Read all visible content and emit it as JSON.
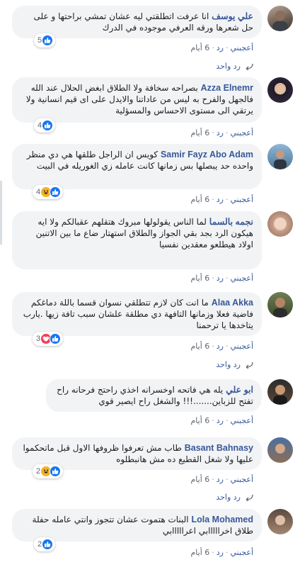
{
  "actions": {
    "like": "أعجبني",
    "reply": "رد",
    "age": "6 أيام",
    "dot": "·"
  },
  "reply_link_label": "رد واحد",
  "comments": [
    {
      "author": "علي يوسف",
      "text": "انا عرفت اتطلقتي ليه عشان تمشي براحتها و على حل شعرها ورقه العرفي موجوده في الدرك",
      "reaction_count": "5",
      "reactions": [
        "like"
      ]
    },
    {
      "author": "Azza Elnemr",
      "text": "بصراحه سخافة ولا الطلاق ابغض الحلال عند الله فالجهل والفرح به ليس من عاداتنا والايدل على اى قيم انسانية ولا يرتقي الى مستوى الاحساس والمسؤلية",
      "reaction_count": "4",
      "reactions": [
        "like"
      ]
    },
    {
      "author": "Samir Fayz Abo Adam",
      "text": "كويس ان الراجل طلقها هي دي منظر واحده حد يبصلها بس زمانها كانت عامله زي الغوريله في البيت",
      "reaction_count": "4",
      "reactions": [
        "like",
        "haha"
      ]
    },
    {
      "author": "نجمه بالسما",
      "text": "لما الناس يقولولها مبروك هتقلهم عقبالكم ولا ايه هيكون الرد بجد بقي الجواز والطلاق استهتار ضاع ما بين الاتنين اولاد هيطلعو معقدين نفسيا",
      "reaction_count": "",
      "reactions": []
    },
    {
      "author": "Alaa Akka",
      "text": "ما انت كان لازم تتطلقي نسوان قسما باللة دماغكم فاضية فعلا وزمانها التافهة دي مطلقة علشان سبب تافة زيها .يارب يتاخدها يا ترحمنا",
      "reaction_count": "3",
      "reactions": [
        "like",
        "love"
      ]
    },
    {
      "author": "ابو علي",
      "text": "يله هي فاتحه اوخسرانه اخذي راحتج فرحانه راح تفتح للزباين.......!!! والشغل راح ايصير قوي",
      "reaction_count": "",
      "reactions": []
    },
    {
      "author": "Basant Bahnasy",
      "text": "طاب مش تعرفوا ظروفها الاول قبل ماتحكموا عليها ولا شغل القطيع ده مش هانبطلوه",
      "reaction_count": "2",
      "reactions": [
        "like",
        "haha"
      ]
    },
    {
      "author": "Lola Mohamed",
      "text": "البنات هتموت عشان تتجوز وانتي عامله حفلة طلاق اخرااااابي اعرااااابي",
      "reaction_count": "2",
      "reactions": [
        "like"
      ]
    }
  ]
}
